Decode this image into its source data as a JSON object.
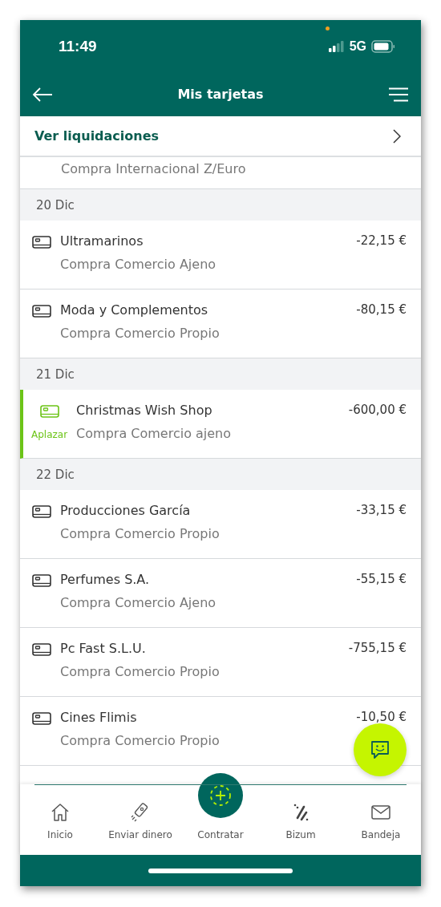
{
  "status_bar": {
    "time": "11:49",
    "network": "5G"
  },
  "header": {
    "title": "Mis tarjetas"
  },
  "settlements_link": {
    "label": "Ver liquidaciones"
  },
  "list": [
    {
      "kind": "partial",
      "subtitle": "Compra Internacional Z/Euro"
    },
    {
      "kind": "date",
      "label": "20 Dic"
    },
    {
      "kind": "transaction",
      "name": "Ultramarinos",
      "amount": "-22,15 €",
      "subtitle": "Compra Comercio Ajeno",
      "highlighted": false
    },
    {
      "kind": "transaction",
      "name": "Moda y Complementos",
      "amount": "-80,15 €",
      "subtitle": "Compra Comercio Propio",
      "highlighted": false
    },
    {
      "kind": "date",
      "label": "21 Dic"
    },
    {
      "kind": "transaction",
      "name": "Christmas Wish Shop",
      "amount": "-600,00 €",
      "subtitle": "Compra Comercio ajeno",
      "highlighted": true,
      "action": "Aplazar"
    },
    {
      "kind": "date",
      "label": "22 Dic"
    },
    {
      "kind": "transaction",
      "name": "Producciones García",
      "amount": "-33,15 €",
      "subtitle": "Compra Comercio Propio",
      "highlighted": false
    },
    {
      "kind": "transaction",
      "name": "Perfumes S.A.",
      "amount": "-55,15 €",
      "subtitle": "Compra Comercio Ajeno",
      "highlighted": false
    },
    {
      "kind": "transaction",
      "name": "Pc Fast S.L.U.",
      "amount": "-755,15 €",
      "subtitle": "Compra Comercio Propio",
      "highlighted": false
    },
    {
      "kind": "transaction",
      "name": "Cines Flimis",
      "amount": "-10,50 €",
      "subtitle": "Compra Comercio Propio",
      "highlighted": false
    }
  ],
  "bottom_nav": [
    {
      "kind": "home",
      "label": "Inicio"
    },
    {
      "kind": "send",
      "label": "Enviar dinero"
    },
    {
      "kind": "center",
      "label": "Contratar"
    },
    {
      "kind": "bizum",
      "label": "Bizum"
    },
    {
      "kind": "mail",
      "label": "Bandeja"
    }
  ]
}
